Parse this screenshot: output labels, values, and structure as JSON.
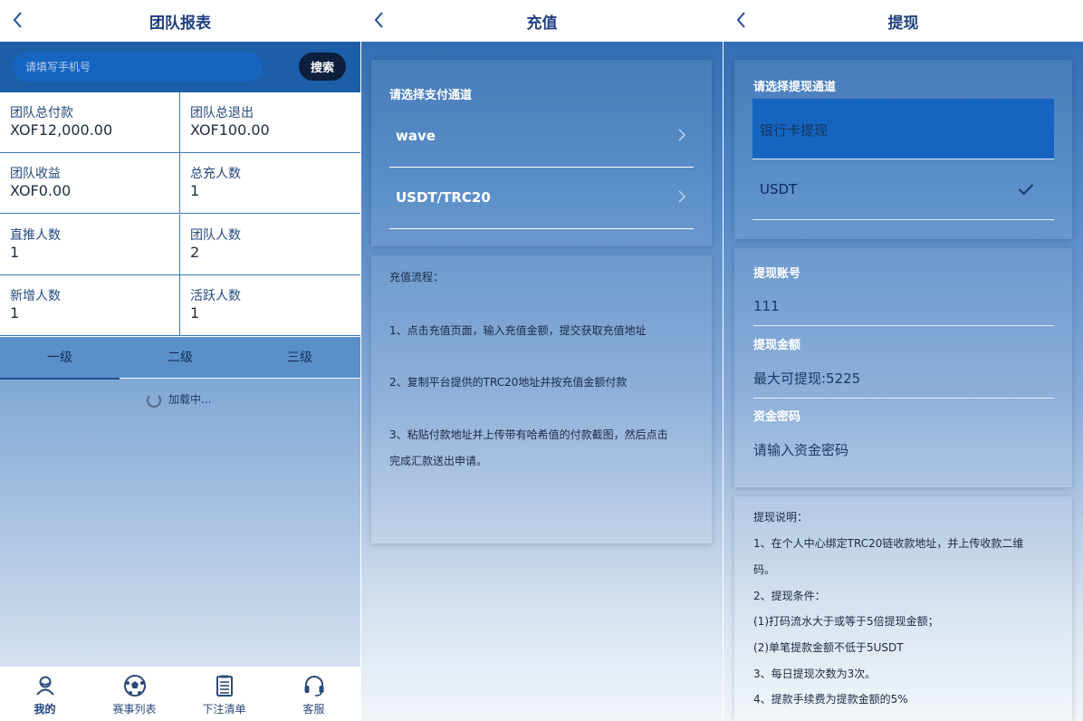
{
  "team_report": {
    "title": "团队报表",
    "search_placeholder": "请填写手机号",
    "search_button": "搜索",
    "stats": [
      {
        "label": "团队总付款",
        "value": "XOF12,000.00"
      },
      {
        "label": "团队总退出",
        "value": "XOF100.00"
      },
      {
        "label": "团队收益",
        "value": "XOF0.00"
      },
      {
        "label": "总充人数",
        "value": "1"
      },
      {
        "label": "直推人数",
        "value": "1"
      },
      {
        "label": "团队人数",
        "value": "2"
      },
      {
        "label": "新增人数",
        "value": "1"
      },
      {
        "label": "活跃人数",
        "value": "1"
      }
    ],
    "tabs": [
      "一级",
      "二级",
      "三级"
    ],
    "loading": "加载中...",
    "nav": [
      {
        "label": "我的",
        "icon": "user-icon"
      },
      {
        "label": "赛事列表",
        "icon": "soccer-ball-icon"
      },
      {
        "label": "下注清单",
        "icon": "clipboard-icon"
      },
      {
        "label": "客服",
        "icon": "headset-icon"
      }
    ]
  },
  "recharge": {
    "title": "充值",
    "channel_label": "请选择支付通道",
    "channels": [
      "wave",
      "USDT/TRC20"
    ],
    "flow_title": "充值流程：",
    "steps": [
      "1、点击充值页面，输入充值金额，提交获取充值地址",
      "2、复制平台提供的TRC20地址并按充值金额付款",
      "3、粘贴付款地址并上传带有哈希值的付款截图，然后点击",
      "完成汇款送出申请。"
    ]
  },
  "withdraw": {
    "title": "提现",
    "channel_label": "请选择提现通道",
    "channels": [
      "银行卡提现",
      "USDT"
    ],
    "account_label": "提现账号",
    "account_value": "111",
    "amount_label": "提现金额",
    "amount_placeholder": "最大可提现:5225",
    "password_label": "资金密码",
    "password_placeholder": "请输入资金密码",
    "notes": [
      "提现说明：",
      "1、在个人中心绑定TRC20链收款地址，并上传收款二维",
      "码。",
      "2、提现条件：",
      "(1)打码流水大于或等于5倍提现金额；",
      "(2)单笔提款金额不低于5USDT",
      "3、每日提现次数为3次。",
      "4、提款手续费为提款金额的5%"
    ]
  }
}
